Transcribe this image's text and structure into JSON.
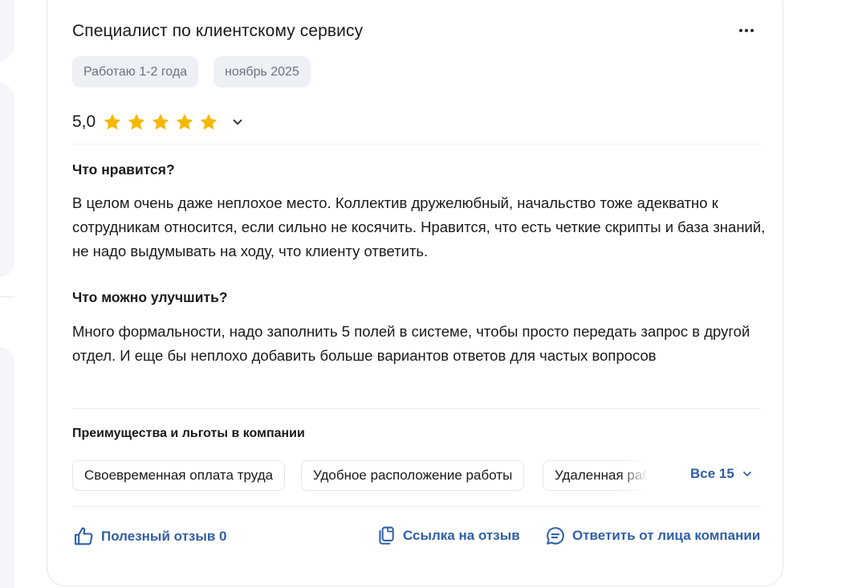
{
  "review": {
    "position": "Специалист по клиентскому сервису",
    "tags": [
      "Работаю 1-2 года",
      "ноябрь 2025"
    ],
    "rating": "5,0",
    "stars_count": 5,
    "likes_label": "Что нравится?",
    "likes_text": "В целом очень даже неплохое место. Коллектив дружелюбный, начальство тоже адекватно к сотрудникам относится, если сильно не косячить. Нравится, что есть четкие скрипты и база знаний, не надо выдумывать на ходу, что клиенту ответить.",
    "improve_label": "Что можно улучшить?",
    "improve_text": "Много формальности, надо заполнить 5 полей в системе, чтобы просто передать запрос в другой отдел. И еще бы неплохо добавить больше вариантов ответов для частых вопросов"
  },
  "benefits": {
    "title": "Преимущества и льготы в компании",
    "items": [
      "Своевременная оплата труда",
      "Удобное расположение работы",
      "Удаленная работа"
    ],
    "all_label": "Все 15"
  },
  "actions": {
    "helpful": "Полезный отзыв 0",
    "link": "Ссылка на отзыв",
    "reply": "Ответить от лица компании"
  },
  "colors": {
    "accent": "#2f5fa8",
    "star": "#f5b800",
    "chip_bg": "#edf0f5"
  },
  "icons": [
    "more-icon",
    "star-icon",
    "chevron-down-icon",
    "thumbs-up-icon",
    "copy-link-icon",
    "chat-reply-icon"
  ]
}
